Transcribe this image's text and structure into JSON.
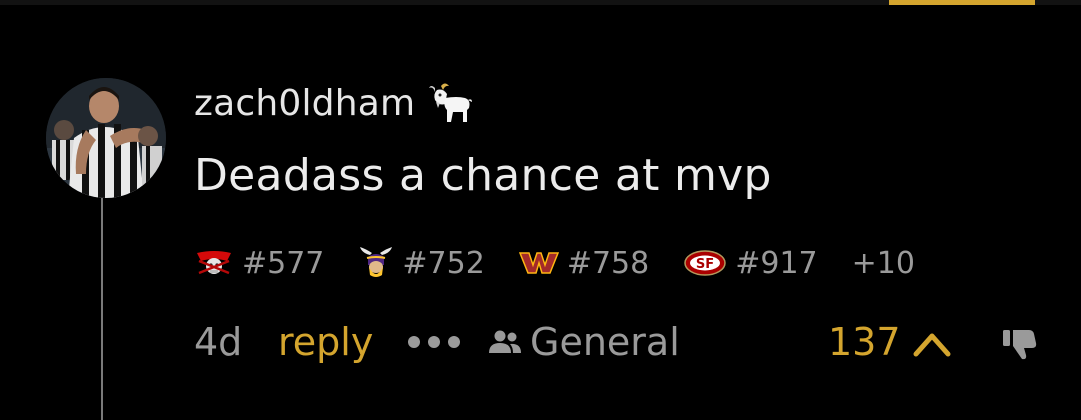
{
  "comment": {
    "username": "zach0ldham",
    "body": "Deadass a chance at mvp",
    "badges": [
      {
        "team": "buccaneers",
        "rank": "#577"
      },
      {
        "team": "vikings",
        "rank": "#752"
      },
      {
        "team": "commanders",
        "rank": "#758"
      },
      {
        "team": "49ers",
        "rank": "#917"
      }
    ],
    "more_badges": "+10",
    "age": "4d",
    "reply_label": "reply",
    "channel": "General",
    "score": "137"
  },
  "colors": {
    "accent": "#d4a52e",
    "muted": "#9a9a9a",
    "background": "#000000",
    "text": "#e6e6e6"
  },
  "icons": [
    "goat-icon",
    "group-icon",
    "upvote-icon",
    "downvote-icon",
    "more-icon"
  ]
}
